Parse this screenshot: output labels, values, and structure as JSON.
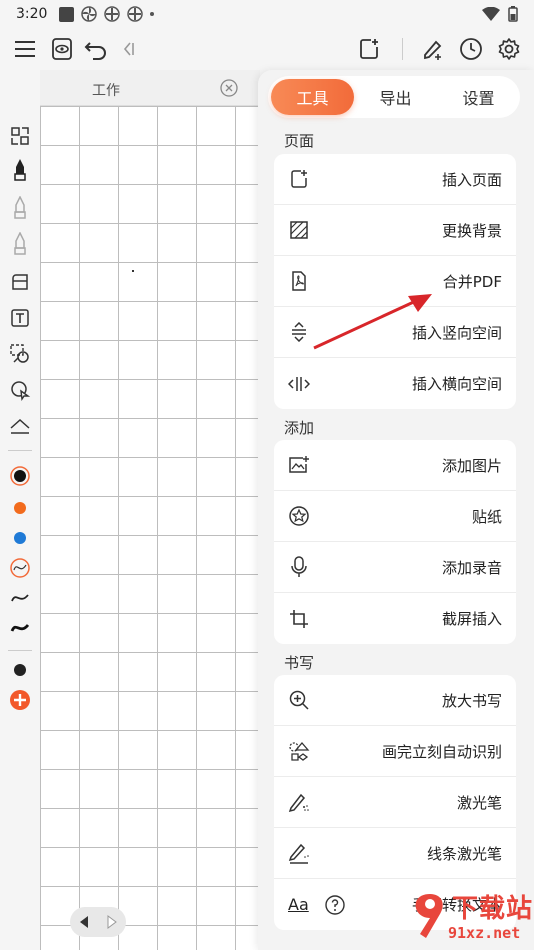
{
  "status_bar": {
    "time": "3:20"
  },
  "document": {
    "tab_title": "工作"
  },
  "panel": {
    "tabs": [
      "工具",
      "导出",
      "设置"
    ],
    "active_tab": 0,
    "sections": [
      {
        "title": "页面",
        "items": [
          {
            "label": "插入页面",
            "icon": "add-page-icon"
          },
          {
            "label": "更换背景",
            "icon": "background-icon"
          },
          {
            "label": "合并PDF",
            "icon": "pdf-icon"
          },
          {
            "label": "插入竖向空间",
            "icon": "vertical-space-icon"
          },
          {
            "label": "插入横向空间",
            "icon": "horizontal-space-icon"
          }
        ]
      },
      {
        "title": "添加",
        "items": [
          {
            "label": "添加图片",
            "icon": "image-add-icon"
          },
          {
            "label": "贴纸",
            "icon": "sticker-icon"
          },
          {
            "label": "添加录音",
            "icon": "microphone-icon"
          },
          {
            "label": "截屏插入",
            "icon": "crop-icon"
          }
        ]
      },
      {
        "title": "书写",
        "items": [
          {
            "label": "放大书写",
            "icon": "zoom-in-icon"
          },
          {
            "label": "画完立刻自动识别",
            "icon": "shape-recognize-icon"
          },
          {
            "label": "激光笔",
            "icon": "laser-pen-icon"
          },
          {
            "label": "线条激光笔",
            "icon": "line-laser-pen-icon"
          },
          {
            "label": "手写转换文本",
            "icon": "text-convert-icon"
          }
        ]
      }
    ]
  },
  "watermark": {
    "main": "下载站",
    "sub": "91xz.net"
  },
  "colors": {
    "accent": "#f26b3a",
    "pen_orange": "#f26b1d",
    "pen_blue": "#1f7ad6",
    "add_button": "#f2582a"
  }
}
